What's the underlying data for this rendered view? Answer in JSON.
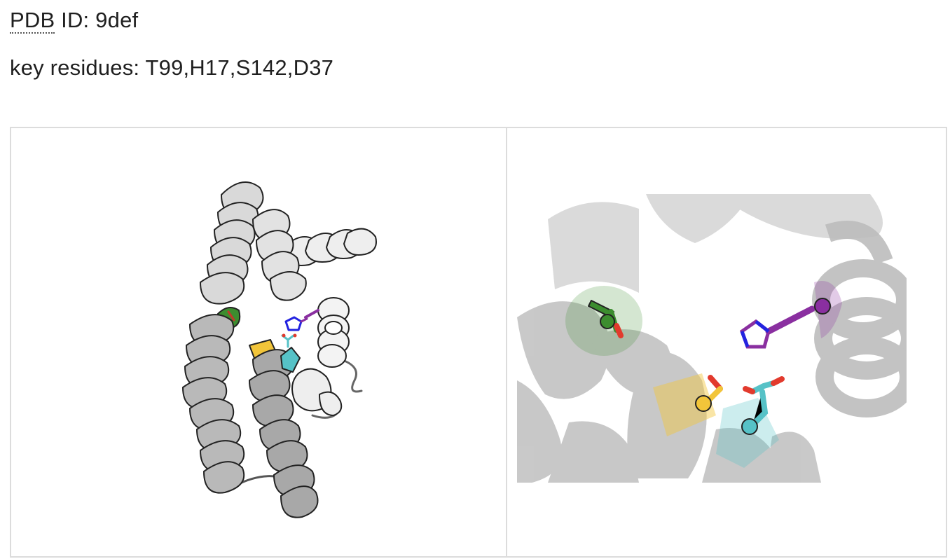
{
  "header": {
    "pdb_label": "PDB",
    "pdb_rest": " ID: 9def",
    "key_residues_label": "key residues: T99,H17,S142,D37"
  },
  "colors": {
    "helix_light": "#d9d9d9",
    "helix_dark": "#a8a8a8",
    "residue_green": "#3c8d2f",
    "residue_purple": "#8a2fa0",
    "residue_yellow": "#f2c53a",
    "residue_cyan": "#56c2c7",
    "oxygen_red": "#e23a2d",
    "nitrogen_blue": "#2323e0"
  },
  "panels": {
    "overview": {
      "icon": "protein-cartoon-overview"
    },
    "zoom": {
      "icon": "binding-site-closeup"
    }
  }
}
